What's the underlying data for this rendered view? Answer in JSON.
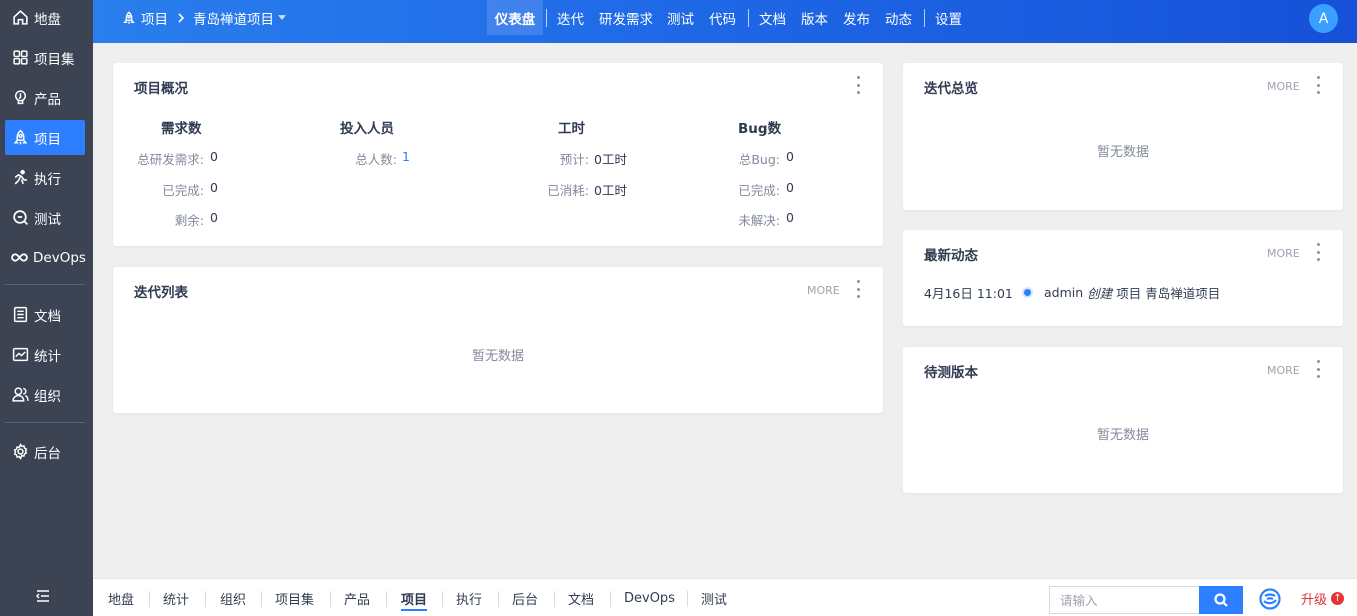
{
  "sidebar": {
    "items": [
      {
        "label": "地盘",
        "icon": "home-icon"
      },
      {
        "label": "项目集",
        "icon": "grid-icon"
      },
      {
        "label": "产品",
        "icon": "lightbulb-icon"
      },
      {
        "label": "项目",
        "icon": "rocket-icon"
      },
      {
        "label": "执行",
        "icon": "runner-icon"
      },
      {
        "label": "测试",
        "icon": "magnifier-icon"
      },
      {
        "label": "DevOps",
        "icon": "infinity-icon"
      },
      {
        "label": "文档",
        "icon": "document-icon"
      },
      {
        "label": "统计",
        "icon": "chart-icon"
      },
      {
        "label": "组织",
        "icon": "people-icon"
      },
      {
        "label": "后台",
        "icon": "gear-icon"
      }
    ],
    "active": "项目"
  },
  "header": {
    "module": "项目",
    "project": "青岛禅道项目",
    "nav": [
      "仪表盘",
      "迭代",
      "研发需求",
      "测试",
      "代码",
      "文档",
      "版本",
      "发布",
      "动态",
      "设置"
    ],
    "active_nav": "仪表盘",
    "avatar": "A"
  },
  "overview": {
    "title": "项目概况",
    "columns": [
      {
        "head": "需求数",
        "rows": [
          {
            "label": "总研发需求:",
            "value": "0"
          },
          {
            "label": "已完成:",
            "value": "0"
          },
          {
            "label": "剩余:",
            "value": "0"
          }
        ]
      },
      {
        "head": "投入人员",
        "rows": [
          {
            "label": "总人数:",
            "value": "1"
          }
        ]
      },
      {
        "head": "工时",
        "rows": [
          {
            "label": "预计:",
            "value": "0工时"
          },
          {
            "label": "已消耗:",
            "value": "0工时"
          }
        ]
      },
      {
        "head": "Bug数",
        "rows": [
          {
            "label": "总Bug:",
            "value": "0"
          },
          {
            "label": "已完成:",
            "value": "0"
          },
          {
            "label": "未解决:",
            "value": "0"
          }
        ]
      }
    ]
  },
  "iteration_list": {
    "title": "迭代列表",
    "more": "MORE",
    "empty": "暂无数据"
  },
  "iteration_overview": {
    "title": "迭代总览",
    "more": "MORE",
    "empty": "暂无数据"
  },
  "latest_activity": {
    "title": "最新动态",
    "more": "MORE",
    "items": [
      {
        "time": "4月16日 11:01",
        "user": "admin",
        "action": "创建",
        "object": "项目",
        "name": "青岛禅道项目"
      }
    ]
  },
  "pending_builds": {
    "title": "待测版本",
    "more": "MORE",
    "empty": "暂无数据"
  },
  "footer": {
    "items": [
      "地盘",
      "统计",
      "组织",
      "项目集",
      "产品",
      "项目",
      "执行",
      "后台",
      "文档",
      "DevOps",
      "测试"
    ],
    "active": "项目",
    "search_placeholder": "请输入",
    "upgrade": "升级"
  },
  "colors": {
    "accent": "#2e7fff",
    "sidebar_bg": "#3c4353",
    "upgrade": "#e53333"
  }
}
